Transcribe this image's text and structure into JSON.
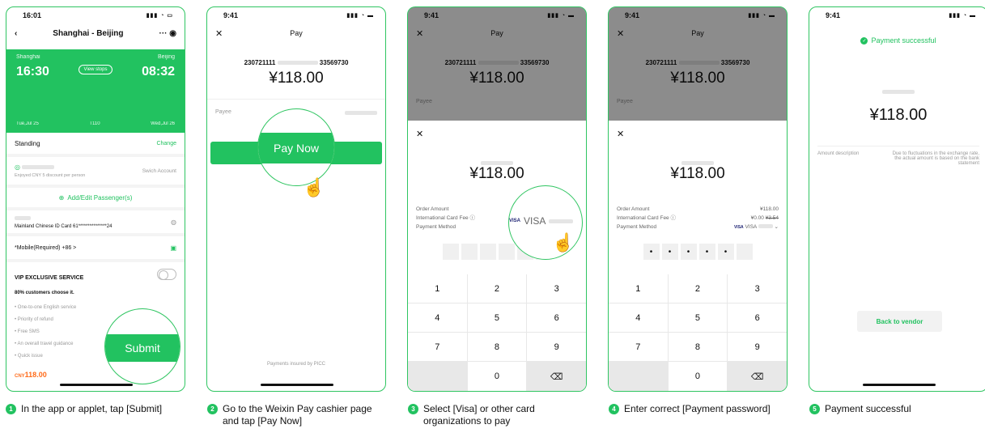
{
  "colors": {
    "brand_green": "#22c260",
    "price_orange": "#ff6b1a"
  },
  "phone1": {
    "status_time": "16:01",
    "title": "Shanghai - Beijing",
    "from_city": "Shanghai",
    "to_city": "Beijing",
    "depart_time": "16:30",
    "arrive_time": "08:32",
    "view_stops": "View stops",
    "depart_date": "Tue,Jul 25",
    "train_no": "T110",
    "arrive_date": "Wed,Jul 26",
    "seat": "Standing",
    "change": "Change",
    "discount": "Enjoyed CNY 5 discount per person",
    "switch_account": "Swich Account",
    "add_passenger": "Add/Edit Passenger(s)",
    "id_card": "Mainland Chinese ID Card   61***************24",
    "mobile": "*Mobile(Required)  +86  >",
    "vip_title": "VIP EXCLUSIVE SERVICE",
    "vip_sub": "80% customers choose it.",
    "vip_items": [
      "One-to-one English service",
      "Priority of refund",
      "Free SMS",
      "An overall travel guidance",
      "Quick issue"
    ],
    "price_prefix": "CNY",
    "price": "118.00",
    "submit": "Submit"
  },
  "phone2": {
    "status_time": "9:41",
    "title": "Pay",
    "card_left": "230721111",
    "card_right": "33569730",
    "amount": "¥118.00",
    "payee": "Payee",
    "pay_now": "Pay Now",
    "insured": "Payments insured by PICC"
  },
  "phone3": {
    "status_time": "9:41",
    "title": "Pay",
    "card_left": "230721111",
    "card_right": "33569730",
    "amount": "¥118.00",
    "payee": "Payee",
    "sheet_amount": "¥118.00",
    "order_amount": "Order Amount",
    "intl_fee": "International Card Fee ⓘ",
    "payment_method": "Payment Method",
    "visa": "VISA",
    "keys": [
      "1",
      "2",
      "3",
      "4",
      "5",
      "6",
      "7",
      "8",
      "9",
      "",
      "0",
      "⌫"
    ]
  },
  "phone4": {
    "status_time": "9:41",
    "title": "Pay",
    "card_left": "230721111",
    "card_right": "33569730",
    "amount": "¥118.00",
    "payee": "Payee",
    "sheet_amount": "¥118.00",
    "order_amount": "Order Amount",
    "order_value": "¥118.00",
    "intl_fee": "International Card Fee ⓘ",
    "fee_value": "¥0.00",
    "fee_old": "¥3.54",
    "payment_method": "Payment Method",
    "visa": "VISA",
    "dots": [
      "•",
      "•",
      "•",
      "•",
      "•",
      ""
    ],
    "keys": [
      "1",
      "2",
      "3",
      "4",
      "5",
      "6",
      "7",
      "8",
      "9",
      "",
      "0",
      "⌫"
    ]
  },
  "phone5": {
    "status_time": "9:41",
    "success": "Payment successful",
    "amount": "¥118.00",
    "desc_label": "Amount description",
    "desc_text": "Due to fluctuations in the exchange rate, the actual amount is based on the bank statement",
    "back": "Back to vendor"
  },
  "captions": [
    {
      "num": "1",
      "text": "In the app or applet, tap [Submit]"
    },
    {
      "num": "2",
      "text": "Go to the Weixin Pay cashier page and tap [Pay Now]"
    },
    {
      "num": "3",
      "text": "Select [Visa] or other card organizations to pay"
    },
    {
      "num": "4",
      "text": "Enter correct [Payment password]"
    },
    {
      "num": "5",
      "text": "Payment successful"
    }
  ]
}
